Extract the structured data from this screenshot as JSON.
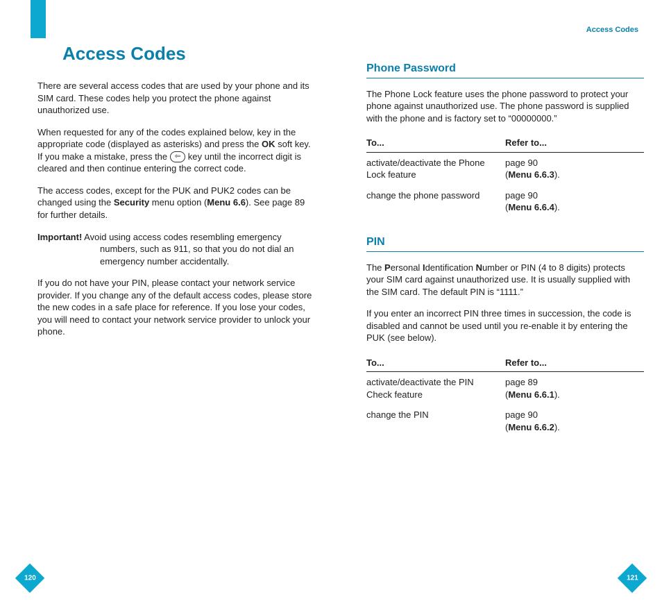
{
  "header": {
    "running": "Access Codes"
  },
  "title": "Access Codes",
  "left": {
    "p1": "There are several access codes that are used by your phone and its SIM card. These codes help you protect the phone against unauthorized use.",
    "p2a": "When requested for any of the codes explained below, key in the appropriate code (displayed as asterisks) and press the ",
    "p2b_bold": "OK",
    "p2c": " soft key. If you make a mistake, press the ",
    "p2d": " key until the incorrect digit is cleared and then continue entering the correct code.",
    "p3a": "The access codes, except for the PUK and PUK2 codes can be changed using the ",
    "p3b_bold": "Security",
    "p3c": " menu option (",
    "p3d_bold": "Menu 6.6",
    "p3e": "). See page 89 for further details.",
    "imp_label": "Important!",
    "imp_text": " Avoid using access codes resembling emergency numbers, such as 911, so that you do not dial an emergency number accidentally.",
    "p4": "If you do not have your PIN, please contact your network service provider. If you change any of the default access codes, please store the new codes in a safe place for reference. If you lose your codes, you will need to contact your network service provider to unlock your phone."
  },
  "phone_pw": {
    "heading": "Phone Password",
    "intro": "The Phone Lock feature uses the phone password to protect your phone against unauthorized use. The phone password is supplied with the phone and is factory set to “00000000.”",
    "th1": "To...",
    "th2": "Refer to...",
    "r1c1": "activate/deactivate the Phone Lock feature",
    "r1c2a": "page 90",
    "r1c2b": "Menu 6.6.3",
    "r2c1": "change the phone password",
    "r2c2a": "page 90",
    "r2c2b": "Menu 6.6.4"
  },
  "pin": {
    "heading": "PIN",
    "intro_a": "The ",
    "intro_P": "P",
    "intro_b": "ersonal ",
    "intro_I": "I",
    "intro_c": "dentification ",
    "intro_N": "N",
    "intro_d": "umber or PIN (4 to 8 digits) protects your SIM card against unauthorized use. It is usually supplied with the SIM card. The default PIN is “1111.”",
    "p2": "If you enter an incorrect PIN three times in succession, the code is disabled and cannot be used until you re-enable it by entering the PUK (see below).",
    "th1": "To...",
    "th2": "Refer to...",
    "r1c1": "activate/deactivate the PIN Check feature",
    "r1c2a": "page 89",
    "r1c2b": "Menu 6.6.1",
    "r2c1": "change the PIN",
    "r2c2a": "page 90",
    "r2c2b": "Menu 6.6.2"
  },
  "footer": {
    "left": "120",
    "right": "121"
  },
  "glyph": {
    "backarrow": "⇦"
  }
}
